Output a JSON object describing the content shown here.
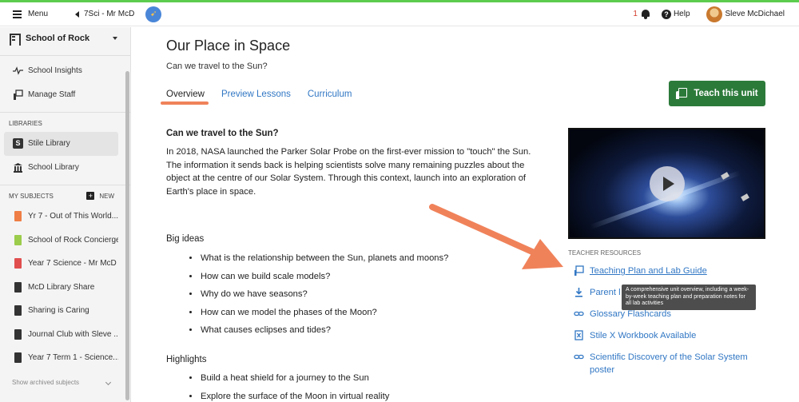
{
  "topbar": {
    "menu_label": "Menu",
    "class_name": "7Sci - Mr McD",
    "notification_count": "1",
    "help_label": "Help",
    "user_name": "Sleve McDichael"
  },
  "sidebar": {
    "school_name": "School of Rock",
    "admin_items": [
      {
        "label": "School Insights",
        "icon": "pulse-icon"
      },
      {
        "label": "Manage Staff",
        "icon": "staff-icon"
      }
    ],
    "libraries_heading": "LIBRARIES",
    "libraries": [
      {
        "label": "Stile Library",
        "icon": "stile-s-icon",
        "active": true
      },
      {
        "label": "School Library",
        "icon": "library-icon",
        "active": false
      }
    ],
    "subjects_heading": "MY SUBJECTS",
    "new_label": "NEW",
    "subjects": [
      {
        "label": "Yr 7 - Out of This World...",
        "color": "#ee7e45"
      },
      {
        "label": "School of Rock Concierge",
        "color": "#9bcc4b"
      },
      {
        "label": "Year 7 Science - Mr McD",
        "color": "#e04e4e"
      },
      {
        "label": "McD Library Share",
        "color": "#333333"
      },
      {
        "label": "Sharing is Caring",
        "color": "#333333"
      },
      {
        "label": "Journal Club with Sleve ...",
        "color": "#333333"
      },
      {
        "label": "Year 7 Term 1 - Science...",
        "color": "#333333"
      }
    ],
    "archived_label": "Show archived subjects"
  },
  "main": {
    "title": "Our Place in Space",
    "subtitle": "Can we travel to the Sun?",
    "tabs": [
      {
        "label": "Overview",
        "active": true
      },
      {
        "label": "Preview Lessons",
        "active": false
      },
      {
        "label": "Curriculum",
        "active": false
      }
    ],
    "teach_button": "Teach this unit",
    "question_title": "Can we travel to the Sun?",
    "intro": "In 2018, NASA launched the Parker Solar Probe on the first-ever mission to \"touch\" the Sun. The information it sends back is helping scientists solve many remaining puzzles about the object at the centre of our Solar System. Through this context, launch into an exploration of Earth's place in space.",
    "big_ideas_heading": "Big ideas",
    "big_ideas": [
      "What is the relationship between the Sun, planets and moons?",
      "How can we build scale models?",
      "Why do we have seasons?",
      "How can we model the phases of the Moon?",
      "What causes eclipses and tides?"
    ],
    "highlights_heading": "Highlights",
    "highlights": [
      "Build a heat shield for a journey to the Sun",
      "Explore the surface of the Moon in virtual reality"
    ]
  },
  "resources": {
    "heading": "TEACHER RESOURCES",
    "items": [
      {
        "label": "Teaching Plan and Lab Guide",
        "icon": "teacher-board-icon",
        "underline": true
      },
      {
        "label": "Parent l",
        "icon": "download-icon",
        "underline": false
      },
      {
        "label": "Glossary Flashcards",
        "icon": "link-icon",
        "underline": false
      },
      {
        "label": "Stile X Workbook Available",
        "icon": "stile-x-icon",
        "underline": false
      },
      {
        "label": "Scientific Discovery of the Solar System poster",
        "icon": "link-icon",
        "underline": false
      }
    ],
    "tooltip": "A comprehensive unit overview, including a week-by-week teaching plan and preparation notes for all lab activities"
  },
  "colors": {
    "accent_green": "#2c7a3a",
    "link_blue": "#3177c4",
    "tab_underline": "#f0825a",
    "annotation_arrow": "#f0825a",
    "top_strip": "#5ccc4e"
  }
}
